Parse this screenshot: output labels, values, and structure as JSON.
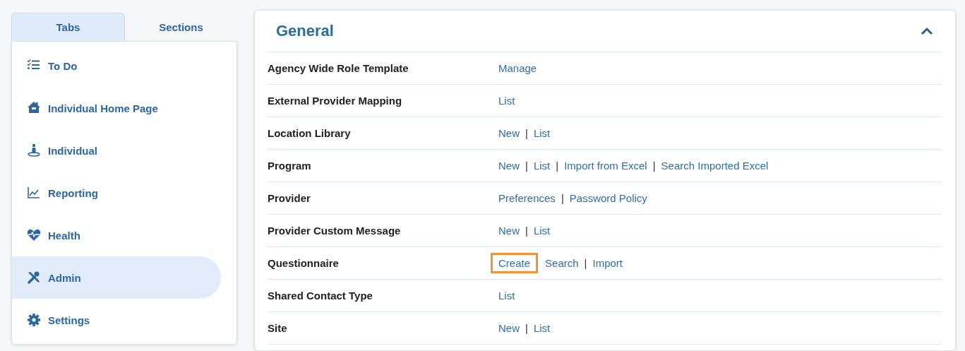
{
  "nav_tabs": [
    {
      "label": "Tabs",
      "selected": true
    },
    {
      "label": "Sections",
      "selected": false
    }
  ],
  "sidebar": {
    "items": [
      {
        "label": "To Do",
        "selected": false
      },
      {
        "label": "Individual Home Page",
        "selected": false
      },
      {
        "label": "Individual",
        "selected": false
      },
      {
        "label": "Reporting",
        "selected": false
      },
      {
        "label": "Health",
        "selected": false
      },
      {
        "label": "Admin",
        "selected": true
      },
      {
        "label": "Settings",
        "selected": false
      }
    ]
  },
  "section": {
    "title": "General",
    "expanded": true,
    "rows": [
      {
        "label": "Agency Wide Role Template",
        "actions": [
          {
            "kind": "link",
            "text": "Manage",
            "highlighted": false
          }
        ]
      },
      {
        "label": "External Provider Mapping",
        "actions": [
          {
            "kind": "link",
            "text": "List",
            "highlighted": false
          }
        ]
      },
      {
        "label": "Location Library",
        "actions": [
          {
            "kind": "link",
            "text": "New",
            "highlighted": false
          },
          {
            "kind": "separator",
            "text": "|"
          },
          {
            "kind": "link",
            "text": "List",
            "highlighted": false
          }
        ]
      },
      {
        "label": "Program",
        "actions": [
          {
            "kind": "link",
            "text": "New",
            "highlighted": false
          },
          {
            "kind": "separator",
            "text": "|"
          },
          {
            "kind": "link",
            "text": "List",
            "highlighted": false
          },
          {
            "kind": "separator",
            "text": "|"
          },
          {
            "kind": "link",
            "text": "Import from Excel",
            "highlighted": false
          },
          {
            "kind": "separator",
            "text": "|"
          },
          {
            "kind": "link",
            "text": "Search Imported Excel",
            "highlighted": false
          }
        ]
      },
      {
        "label": "Provider",
        "actions": [
          {
            "kind": "link",
            "text": "Preferences",
            "highlighted": false
          },
          {
            "kind": "separator",
            "text": "|"
          },
          {
            "kind": "link",
            "text": "Password Policy",
            "highlighted": false
          }
        ]
      },
      {
        "label": "Provider Custom Message",
        "actions": [
          {
            "kind": "link",
            "text": "New",
            "highlighted": false
          },
          {
            "kind": "separator",
            "text": "|"
          },
          {
            "kind": "link",
            "text": "List",
            "highlighted": false
          }
        ]
      },
      {
        "label": "Questionnaire",
        "actions": [
          {
            "kind": "link",
            "text": "Create",
            "highlighted": true
          },
          {
            "kind": "link",
            "text": "Search",
            "highlighted": false
          },
          {
            "kind": "separator",
            "text": "|"
          },
          {
            "kind": "link",
            "text": "Import",
            "highlighted": false
          }
        ]
      },
      {
        "label": "Shared Contact Type",
        "actions": [
          {
            "kind": "link",
            "text": "List",
            "highlighted": false
          }
        ]
      },
      {
        "label": "Site",
        "actions": [
          {
            "kind": "link",
            "text": "New",
            "highlighted": false
          },
          {
            "kind": "separator",
            "text": "|"
          },
          {
            "kind": "link",
            "text": "List",
            "highlighted": false
          }
        ]
      }
    ]
  }
}
